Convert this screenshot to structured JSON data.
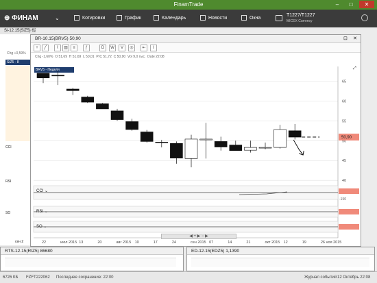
{
  "window": {
    "title": "FinamTrade",
    "minimize": "–",
    "maximize": "□",
    "close": "✕"
  },
  "menubar": {
    "logo": "ФИНАМ",
    "items": [
      {
        "label": "Котировки",
        "icon": "quotes-icon"
      },
      {
        "label": "График",
        "icon": "chart-icon"
      },
      {
        "label": "Календарь",
        "icon": "calendar-icon"
      },
      {
        "label": "Новости",
        "icon": "news-icon"
      },
      {
        "label": "Окна",
        "icon": "windows-icon"
      }
    ],
    "account": "T1227/T1227",
    "account_sub": "MICEX Currency"
  },
  "si_window": {
    "title": "Si-12.15(SiZ5) 62964",
    "change": "Chg +0,59%",
    "series_tag": "SiZ5 - 8",
    "indicators": [
      "CCI",
      "RSI",
      "SO"
    ],
    "x_label": "сен 2"
  },
  "br_window": {
    "title": "BR-10.15(BRV5) 50,90",
    "toolbar": [
      "D",
      "W",
      "V",
      "◎",
      "⇤",
      "I"
    ],
    "stats": {
      "chg": "Chg -1,60%",
      "open": "O 51,69",
      "high": "H 51,69",
      "low": "L 50,01",
      "prev": "PrC 51,72",
      "close": "C 50,90",
      "vol": "Vol 9,0 тыс.",
      "date": "Date 22:08"
    },
    "series_label": "BRV5 - Неделя",
    "price_label": "50,90",
    "indicators": [
      {
        "name": "CCI",
        "value": "-150"
      },
      {
        "name": "RSI",
        "value": ""
      },
      {
        "name": "SO",
        "value": ""
      }
    ]
  },
  "rts_window": {
    "title": "RTS-12.15(RIZ5) 86680"
  },
  "ed_window": {
    "title": "ED-12.15(EDZ5) 1,1390"
  },
  "status": {
    "memory": "6726 КБ",
    "account": "FZFT222062",
    "saved": "Последнее сохранение: 22:00",
    "journal": "Журнал событий",
    "datetime": "12 Октябрь 22:08"
  },
  "chart_data": {
    "type": "candlestick",
    "title": "BRV5 - Неделя",
    "y_ticks": [
      40,
      45,
      50,
      55,
      60,
      65
    ],
    "ylim": [
      39,
      68
    ],
    "x_ticks": [
      "22",
      "июл 2015",
      "13",
      "20",
      "авг 2015",
      "10",
      "17",
      "24",
      "сен 2015",
      "07",
      "14",
      "21",
      "окт 2015",
      "12",
      "19",
      "26 ноя 2015"
    ],
    "last_price": 50.9,
    "candles": [
      {
        "o": 67.0,
        "h": 67.0,
        "l": 64.5,
        "c": 65.8
      },
      {
        "o": 66.5,
        "h": 67.5,
        "l": 64.0,
        "c": 66.3
      },
      {
        "o": 63.0,
        "h": 63.3,
        "l": 61.5,
        "c": 62.6
      },
      {
        "o": 61.0,
        "h": 61.3,
        "l": 59.5,
        "c": 59.7
      },
      {
        "o": 59.3,
        "h": 59.5,
        "l": 58.3,
        "c": 58.0
      },
      {
        "o": 57.5,
        "h": 58.0,
        "l": 55.0,
        "c": 55.3
      },
      {
        "o": 54.8,
        "h": 55.5,
        "l": 52.5,
        "c": 52.8
      },
      {
        "o": 52.2,
        "h": 52.7,
        "l": 49.5,
        "c": 49.8
      },
      {
        "o": 49.6,
        "h": 50.2,
        "l": 48.3,
        "c": 49.5
      },
      {
        "o": 49.3,
        "h": 49.8,
        "l": 44.2,
        "c": 45.6
      },
      {
        "o": 45.5,
        "h": 51.5,
        "l": 43.3,
        "c": 50.4
      },
      {
        "o": 50.2,
        "h": 54.5,
        "l": 45.5,
        "c": 50.4
      },
      {
        "o": 49.8,
        "h": 51.0,
        "l": 47.5,
        "c": 48.4
      },
      {
        "o": 48.9,
        "h": 50.0,
        "l": 47.5,
        "c": 47.5
      },
      {
        "o": 47.6,
        "h": 50.0,
        "l": 47.0,
        "c": 48.3
      },
      {
        "o": 48.3,
        "h": 49.5,
        "l": 47.8,
        "c": 48.3
      },
      {
        "o": 48.3,
        "h": 54.0,
        "l": 48.0,
        "c": 52.8
      },
      {
        "o": 52.5,
        "h": 54.2,
        "l": 50.3,
        "c": 50.9
      }
    ]
  }
}
